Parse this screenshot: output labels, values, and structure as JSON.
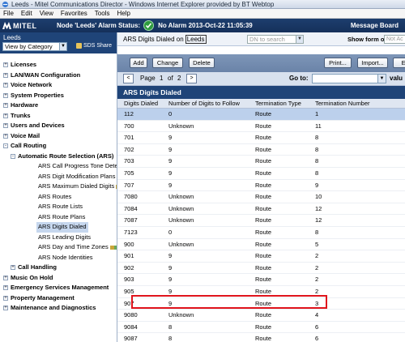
{
  "window": {
    "title": "Leeds - Mitel Communications Director - Windows Internet Explorer provided by BT Webtop"
  },
  "menu": {
    "items": [
      "File",
      "Edit",
      "View",
      "Favorites",
      "Tools",
      "Help"
    ]
  },
  "header": {
    "logo": "MITEL",
    "node_label": "Node 'Leeds' Alarm Status:",
    "alarm": "No Alarm 2013-Oct-22 11:05:39",
    "message_board": "Message Board"
  },
  "sidebar": {
    "title": "Leeds",
    "view_select": "View by Category",
    "sds_label": "SDS Share",
    "items": [
      {
        "label": "Licenses",
        "level": 0,
        "toggle": "+"
      },
      {
        "label": "LAN/WAN Configuration",
        "level": 0,
        "toggle": "+"
      },
      {
        "label": "Voice Network",
        "level": 0,
        "toggle": "+"
      },
      {
        "label": "System Properties",
        "level": 0,
        "toggle": "+"
      },
      {
        "label": "Hardware",
        "level": 0,
        "toggle": "+"
      },
      {
        "label": "Trunks",
        "level": 0,
        "toggle": "+"
      },
      {
        "label": "Users and Devices",
        "level": 0,
        "toggle": "+"
      },
      {
        "label": "Voice Mail",
        "level": 0,
        "toggle": "+"
      },
      {
        "label": "Call Routing",
        "level": 0,
        "toggle": "-"
      },
      {
        "label": "Automatic Route Selection (ARS)",
        "level": 1,
        "toggle": "-"
      },
      {
        "label": "ARS Call Progress Tone Detecti",
        "level": 2
      },
      {
        "label": "ARS Digit Modification Plans",
        "level": 2,
        "wand": true
      },
      {
        "label": "ARS Maximum Dialed Digits",
        "level": 2,
        "wand": true
      },
      {
        "label": "ARS Routes",
        "level": 2
      },
      {
        "label": "ARS Route Lists",
        "level": 2
      },
      {
        "label": "ARS Route Plans",
        "level": 2
      },
      {
        "label": "ARS Digits Dialed",
        "level": 2,
        "selected": true
      },
      {
        "label": "ARS Leading Digits",
        "level": 2
      },
      {
        "label": "ARS Day and Time Zones",
        "level": 2,
        "wand": true
      },
      {
        "label": "ARS Node Identities",
        "level": 2
      },
      {
        "label": "Call Handling",
        "level": 1,
        "toggle": "+"
      },
      {
        "label": "Music On Hold",
        "level": 0,
        "toggle": "+"
      },
      {
        "label": "Emergency Services Management",
        "level": 0,
        "toggle": "+"
      },
      {
        "label": "Property Management",
        "level": 0,
        "toggle": "+"
      },
      {
        "label": "Maintenance and Diagnostics",
        "level": 0,
        "toggle": "+"
      }
    ]
  },
  "subheader": {
    "on_text": "ARS Digits Dialed on",
    "node": "Leeds",
    "dn_search_placeholder": "DN to search",
    "show_form_label": "Show form on",
    "show_form_value": "Not Ac"
  },
  "toolbar": {
    "add": "Add",
    "change": "Change",
    "delete": "Delete",
    "print": "Print...",
    "import": "Import...",
    "export": "Ex"
  },
  "pager": {
    "prev": "<",
    "next": ">",
    "page_word": "Page",
    "page": "1",
    "of_word": "of",
    "total": "2",
    "goto": "Go to:",
    "value": "valu"
  },
  "table": {
    "title": "ARS Digits Dialed",
    "columns": [
      "Digits Dialed",
      "Number of Digits to Follow",
      "Termination Type",
      "Termination Number"
    ],
    "rows": [
      [
        "112",
        "0",
        "Route",
        "1"
      ],
      [
        "700",
        "Unknown",
        "Route",
        "11"
      ],
      [
        "701",
        "9",
        "Route",
        "8"
      ],
      [
        "702",
        "9",
        "Route",
        "8"
      ],
      [
        "703",
        "9",
        "Route",
        "8"
      ],
      [
        "705",
        "9",
        "Route",
        "8"
      ],
      [
        "707",
        "9",
        "Route",
        "9"
      ],
      [
        "7080",
        "Unknown",
        "Route",
        "10"
      ],
      [
        "7084",
        "Unknown",
        "Route",
        "12"
      ],
      [
        "7087",
        "Unknown",
        "Route",
        "12"
      ],
      [
        "7123",
        "0",
        "Route",
        "8"
      ],
      [
        "900",
        "Unknown",
        "Route",
        "5"
      ],
      [
        "901",
        "9",
        "Route",
        "2"
      ],
      [
        "902",
        "9",
        "Route",
        "2"
      ],
      [
        "903",
        "9",
        "Route",
        "2"
      ],
      [
        "905",
        "9",
        "Route",
        "2"
      ],
      [
        "907",
        "9",
        "Route",
        "3"
      ],
      [
        "9080",
        "Unknown",
        "Route",
        "4"
      ],
      [
        "9084",
        "8",
        "Route",
        "6"
      ],
      [
        "9087",
        "8",
        "Route",
        "6"
      ]
    ],
    "selected_row": 0,
    "highlighted_row": 16
  }
}
